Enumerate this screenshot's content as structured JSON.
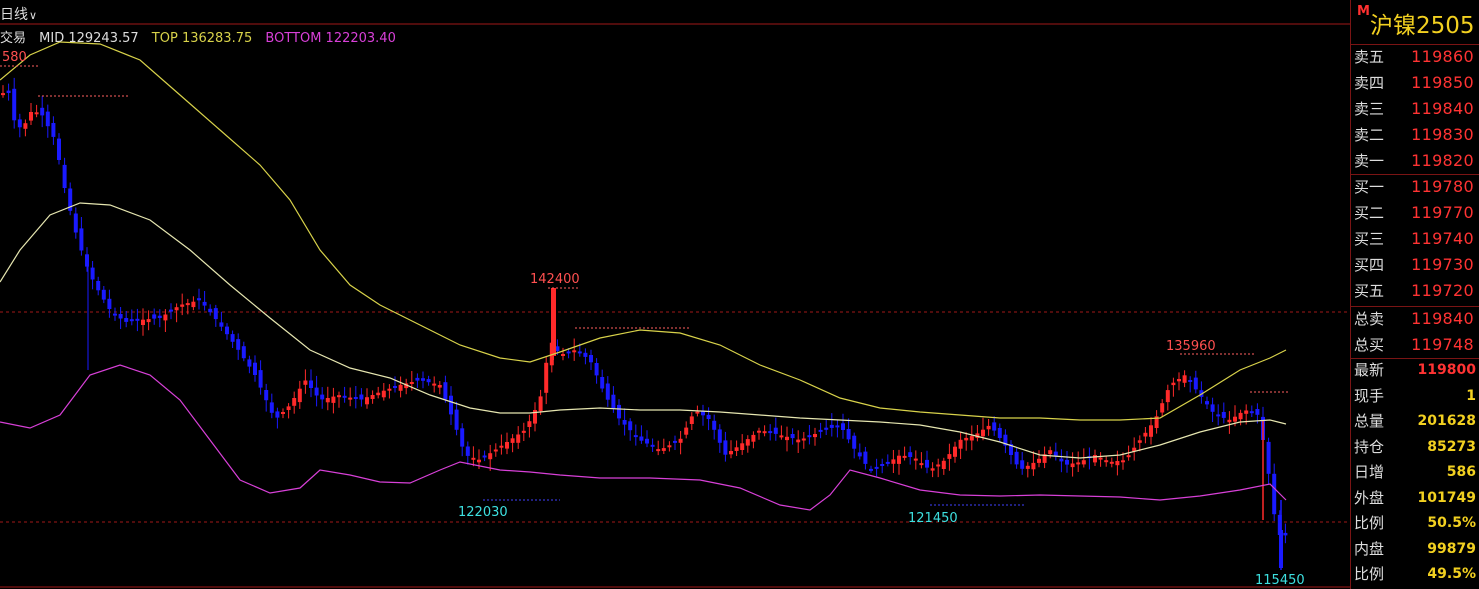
{
  "chart": {
    "period_label": "日线",
    "legend": {
      "trade": "交易",
      "mid": "MID 129243.57",
      "top": "TOP 136283.75",
      "bottom": "BOTTOM 122203.40"
    },
    "annotations": {
      "high_left": "580",
      "peak1": "142400",
      "low1": "122030",
      "low2": "121450",
      "peak2": "135960",
      "low3": "115450"
    },
    "colors": {
      "up": "#ff2a2a",
      "down": "#1a1aff",
      "mid": "#e6e6b0",
      "top": "#d8d24a",
      "bottom": "#d840d8",
      "grid": "#a01818"
    }
  },
  "chart_data": {
    "type": "candlestick",
    "series": [
      {
        "name": "MID",
        "value": 129243.57
      },
      {
        "name": "TOP",
        "value": 136283.75
      },
      {
        "name": "BOTTOM",
        "value": 122203.4
      }
    ],
    "annotated_extremes": [
      142400,
      122030,
      121450,
      135960,
      115450
    ]
  },
  "panel": {
    "badge": "M",
    "instrument": "沪镍2505",
    "asks": [
      {
        "label": "卖五",
        "price": "119860"
      },
      {
        "label": "卖四",
        "price": "119850"
      },
      {
        "label": "卖三",
        "price": "119840"
      },
      {
        "label": "卖二",
        "price": "119830"
      },
      {
        "label": "卖一",
        "price": "119820"
      }
    ],
    "bids": [
      {
        "label": "买一",
        "price": "119780"
      },
      {
        "label": "买二",
        "price": "119770"
      },
      {
        "label": "买三",
        "price": "119740"
      },
      {
        "label": "买四",
        "price": "119730"
      },
      {
        "label": "买五",
        "price": "119720"
      }
    ],
    "totals": [
      {
        "label": "总卖",
        "value": "119840"
      },
      {
        "label": "总买",
        "value": "119748"
      }
    ],
    "stats": [
      {
        "label": "最新",
        "value": "119800",
        "color": "red"
      },
      {
        "label": "现手",
        "value": "1",
        "color": "yellow"
      },
      {
        "label": "总量",
        "value": "201628",
        "color": "yellow"
      },
      {
        "label": "持仓",
        "value": "85273",
        "color": "yellow"
      },
      {
        "label": "日增",
        "value": "586",
        "color": "yellow"
      },
      {
        "label": "外盘",
        "value": "101749",
        "color": "yellow"
      },
      {
        "label": "比例",
        "value": "50.5%",
        "color": "yellow"
      },
      {
        "label": "内盘",
        "value": "99879",
        "color": "yellow"
      },
      {
        "label": "比例",
        "value": "49.5%",
        "color": "yellow"
      }
    ]
  }
}
